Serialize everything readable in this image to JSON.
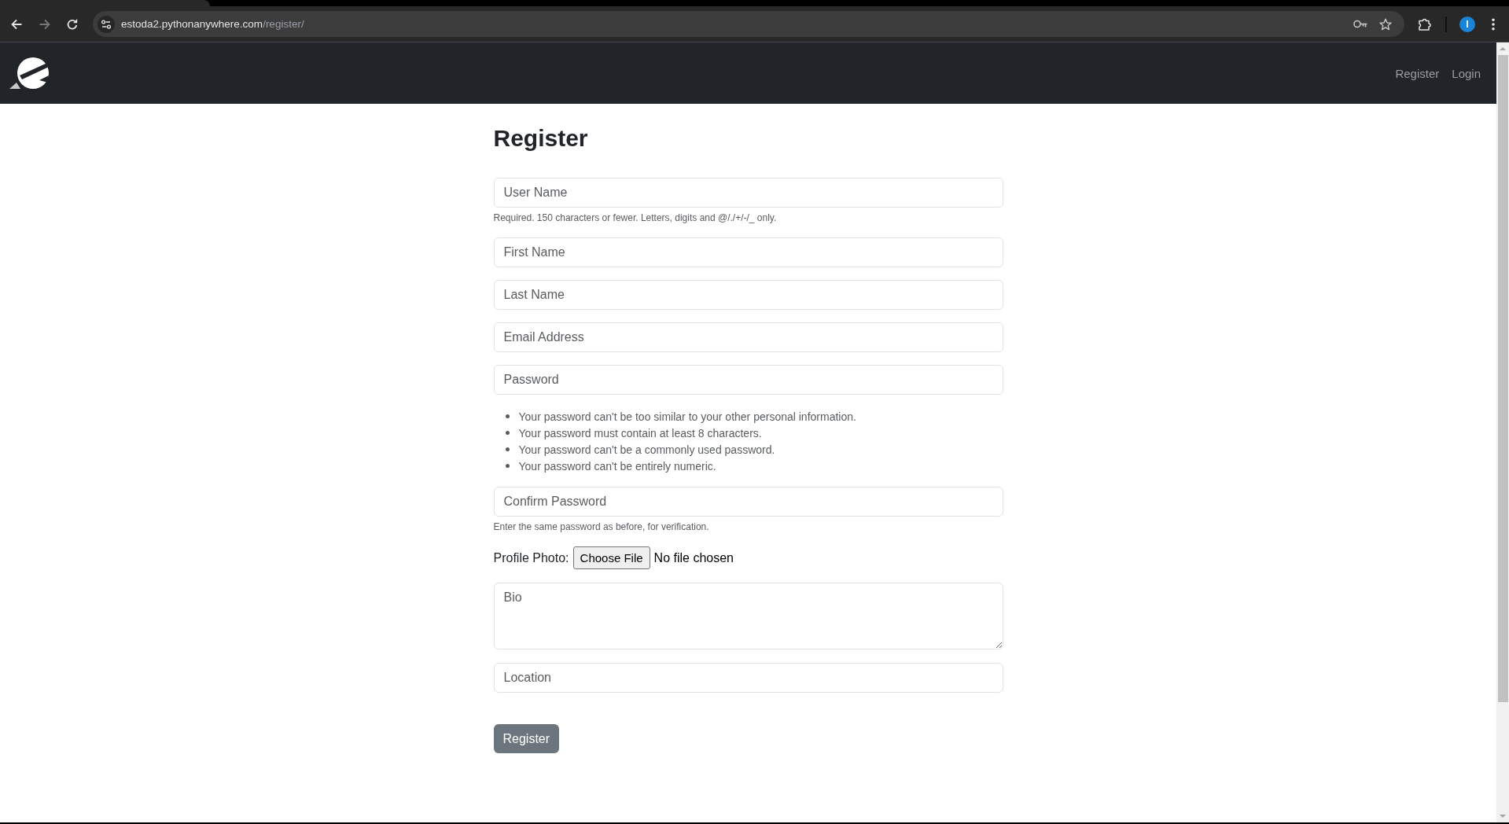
{
  "browser": {
    "url_host": "estoda2.pythonanywhere.com",
    "url_path": "/register/",
    "profile_initial": "I"
  },
  "navbar": {
    "links": [
      {
        "label": "Register"
      },
      {
        "label": "Login"
      }
    ]
  },
  "page": {
    "title": "Register"
  },
  "form": {
    "fields": [
      {
        "kind": "input",
        "placeholder": "User Name",
        "help": "Required. 150 characters or fewer. Letters, digits and @/./+/-/_ only."
      },
      {
        "kind": "input",
        "placeholder": "First Name"
      },
      {
        "kind": "input",
        "placeholder": "Last Name"
      },
      {
        "kind": "input",
        "placeholder": "Email Address"
      },
      {
        "kind": "input",
        "placeholder": "Password",
        "help_items": [
          "Your password can't be too similar to your other personal information.",
          "Your password must contain at least 8 characters.",
          "Your password can't be a commonly used password.",
          "Your password can't be entirely numeric."
        ]
      },
      {
        "kind": "input",
        "placeholder": "Confirm Password",
        "help": "Enter the same password as before, for verification."
      },
      {
        "kind": "file",
        "label": "Profile Photo:",
        "button": "Choose File",
        "status": "No file chosen"
      },
      {
        "kind": "textarea",
        "placeholder": "Bio"
      },
      {
        "kind": "input",
        "placeholder": "Location"
      }
    ],
    "submit": "Register"
  }
}
